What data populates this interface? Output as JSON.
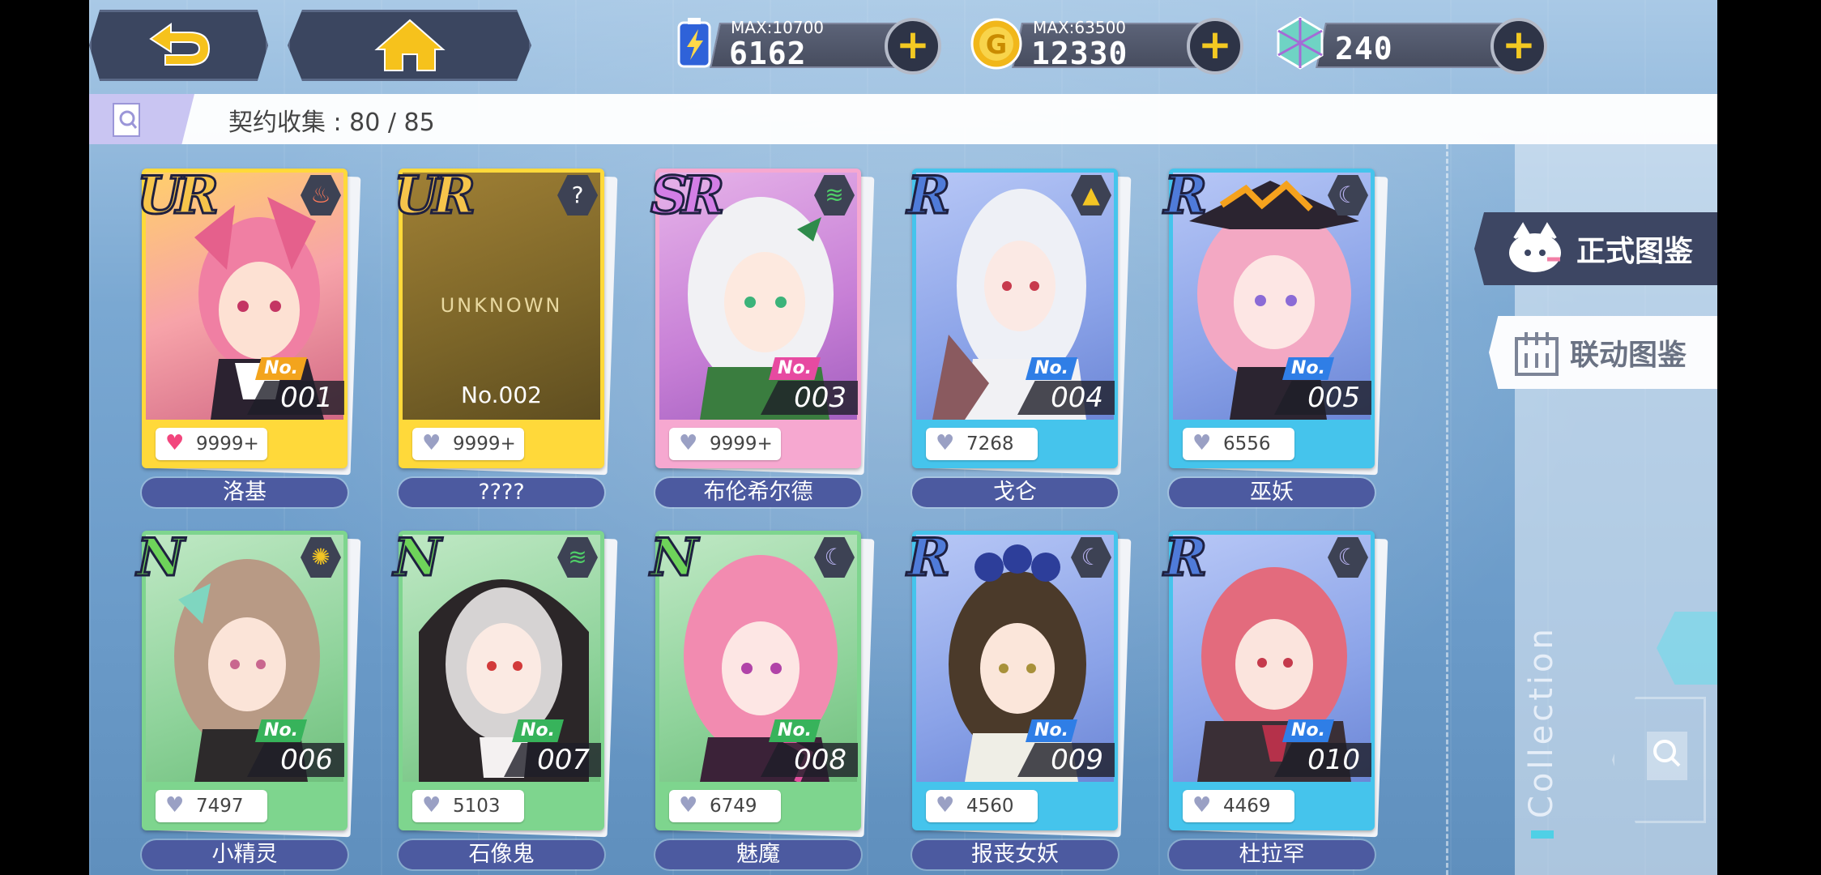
{
  "topbar": {
    "energy": {
      "max_label": "MAX:",
      "max_value": "10700",
      "value": "6162"
    },
    "gold": {
      "max_label": "MAX:",
      "max_value": "63500",
      "value": "12330"
    },
    "gems": {
      "value": "240"
    },
    "plus": "+"
  },
  "collection": {
    "label": "契约收集 : 80 / 85"
  },
  "side": {
    "official": "正式图鉴",
    "collab": "联动图鉴",
    "vertical": "Collection"
  },
  "cards": [
    {
      "rarity": "UR",
      "no_label": "No.",
      "number": "001",
      "likes": "9999+",
      "name": "洛基",
      "liked": true
    },
    {
      "rarity": "UR",
      "no_label": "",
      "number": "",
      "likes": "9999+",
      "name": "????",
      "liked": false,
      "unknown_text": "UNKNOWN",
      "unknown_no": "No.002"
    },
    {
      "rarity": "SR",
      "no_label": "No.",
      "number": "003",
      "likes": "9999+",
      "name": "布伦希尔德",
      "liked": false
    },
    {
      "rarity": "R",
      "no_label": "No.",
      "number": "004",
      "likes": "7268",
      "name": "戈仑",
      "liked": false
    },
    {
      "rarity": "R",
      "no_label": "No.",
      "number": "005",
      "likes": "6556",
      "name": "巫妖",
      "liked": false
    },
    {
      "rarity": "N",
      "no_label": "No.",
      "number": "006",
      "likes": "7497",
      "name": "小精灵",
      "liked": false
    },
    {
      "rarity": "N",
      "no_label": "No.",
      "number": "007",
      "likes": "5103",
      "name": "石像鬼",
      "liked": false
    },
    {
      "rarity": "N",
      "no_label": "No.",
      "number": "008",
      "likes": "6749",
      "name": "魅魔",
      "liked": false
    },
    {
      "rarity": "R",
      "no_label": "No.",
      "number": "009",
      "likes": "4560",
      "name": "报丧女妖",
      "liked": false
    },
    {
      "rarity": "R",
      "no_label": "No.",
      "number": "010",
      "likes": "4469",
      "name": "杜拉罕",
      "liked": false
    }
  ],
  "glyphs": {
    "heart": "♥",
    "question": "?"
  }
}
